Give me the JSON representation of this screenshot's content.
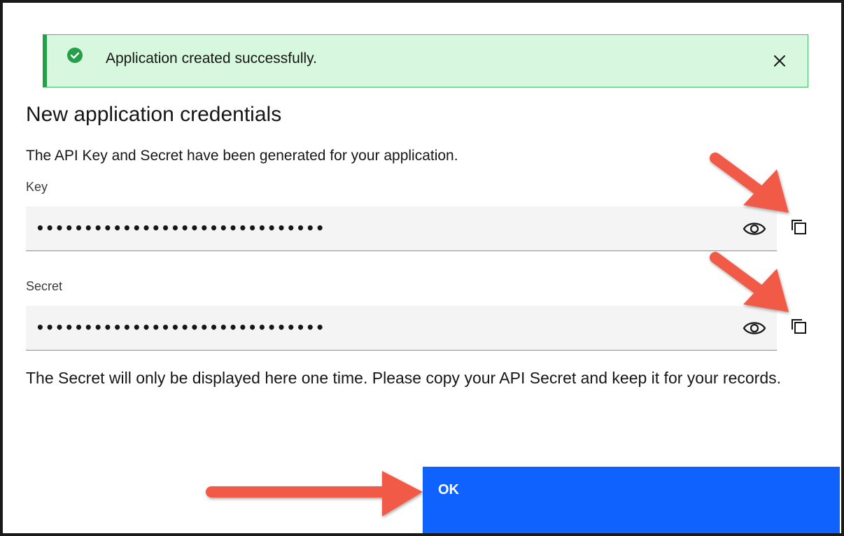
{
  "notification": {
    "message": "Application created successfully.",
    "status_color": "#24a148",
    "icon": "checkmark-filled-icon",
    "close_icon": "close-icon"
  },
  "dialog": {
    "title": "New application credentials",
    "description": "The API Key and Secret have been generated for your application.",
    "fields": {
      "key": {
        "label": "Key",
        "value": "••••••••••••••••••••••••••••••",
        "reveal_icon": "view-eye-icon",
        "copy_icon": "copy-icon"
      },
      "secret": {
        "label": "Secret",
        "value": "••••••••••••••••••••••••••••••",
        "reveal_icon": "view-eye-icon",
        "copy_icon": "copy-icon"
      }
    },
    "note": "The Secret will only be displayed here one time. Please copy your API Secret and keep it for your records.",
    "primary_button": "OK"
  },
  "colors": {
    "primary": "#0f62fe",
    "annotation_arrow": "#f05a46",
    "notification_bg": "#d7f8df"
  }
}
